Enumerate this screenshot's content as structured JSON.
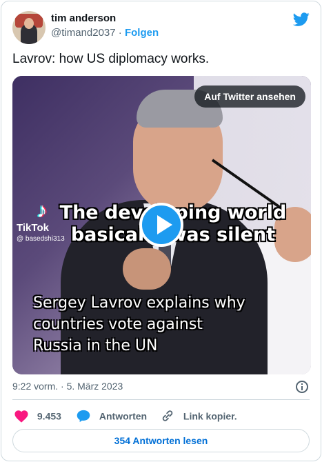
{
  "author": {
    "display_name": "tim anderson",
    "handle": "@timand2037",
    "separator": "·",
    "follow_label": "Folgen"
  },
  "tweet": {
    "text": "Lavrov: how US diplomacy works.",
    "timestamp": "9:22 vorm. · 5. März 2023"
  },
  "media": {
    "overlay_button": "Auf Twitter ansehen",
    "caption_top": "The developing world basically was silent",
    "caption_bottom_lines": [
      "Sergey Lavrov explains why",
      "countries vote against",
      "Russia in the UN"
    ],
    "tiktok_name": "TikTok",
    "tiktok_user": "@ basedshi313"
  },
  "actions": {
    "likes": "9.453",
    "reply_label": "Antworten",
    "link_label": "Link kopier."
  },
  "read_replies": "354 Antworten lesen",
  "colors": {
    "brand_blue": "#1d9bf0",
    "like_red": "#f91880"
  },
  "icons": [
    "twitter-bird-icon",
    "heart-icon",
    "reply-bubble-icon",
    "link-icon",
    "info-icon",
    "play-icon"
  ]
}
